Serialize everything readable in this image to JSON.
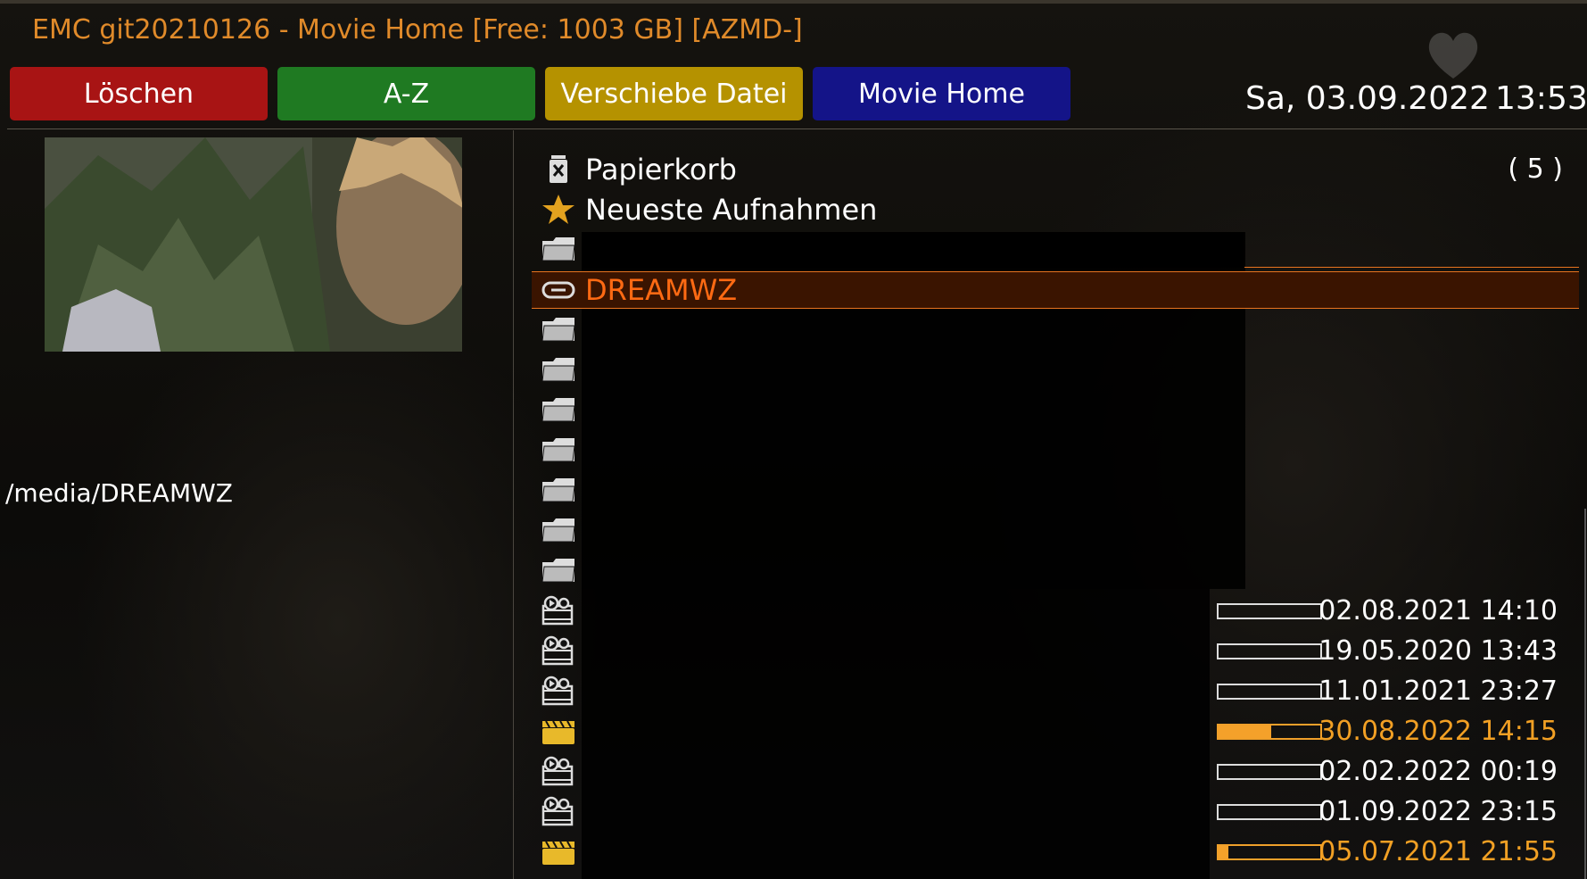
{
  "header": {
    "title": "EMC git20210126 - Movie Home [Free: 1003 GB] [AZMD-]",
    "date": "Sa, 03.09.2022",
    "time": "13:53"
  },
  "buttons": {
    "red": "Löschen",
    "green": "A-Z",
    "yellow": "Verschiebe Datei",
    "blue": "Movie Home"
  },
  "preview": {
    "path": "/media/DREAMWZ"
  },
  "list": {
    "trash": {
      "label": "Papierkorb",
      "count": "( 5 )"
    },
    "recent": {
      "label": "Neueste Aufnahmen"
    },
    "selected": {
      "label": "DREAMWZ"
    },
    "recordings": [
      {
        "date": "02.08.2021 14:10",
        "progress": 0,
        "played": false,
        "icon": "video-file-icon"
      },
      {
        "date": "19.05.2020 13:43",
        "progress": 0,
        "played": false,
        "icon": "video-file-icon"
      },
      {
        "date": "11.01.2021 23:27",
        "progress": 0,
        "played": false,
        "icon": "video-file-icon"
      },
      {
        "date": "30.08.2022 14:15",
        "progress": 52,
        "played": true,
        "icon": "clapperboard-icon"
      },
      {
        "date": "02.02.2022 00:19",
        "progress": 0,
        "played": false,
        "icon": "video-file-icon"
      },
      {
        "date": "01.09.2022 23:15",
        "progress": 0,
        "played": false,
        "icon": "video-file-icon"
      },
      {
        "date": "05.07.2021 21:55",
        "progress": 10,
        "played": true,
        "icon": "clapperboard-icon"
      }
    ]
  },
  "colors": {
    "accent": "#e08a2a",
    "selection": "#ff6a13",
    "red": "#a81414",
    "green": "#1f7a22",
    "yellow": "#b59200",
    "blue": "#141488"
  }
}
